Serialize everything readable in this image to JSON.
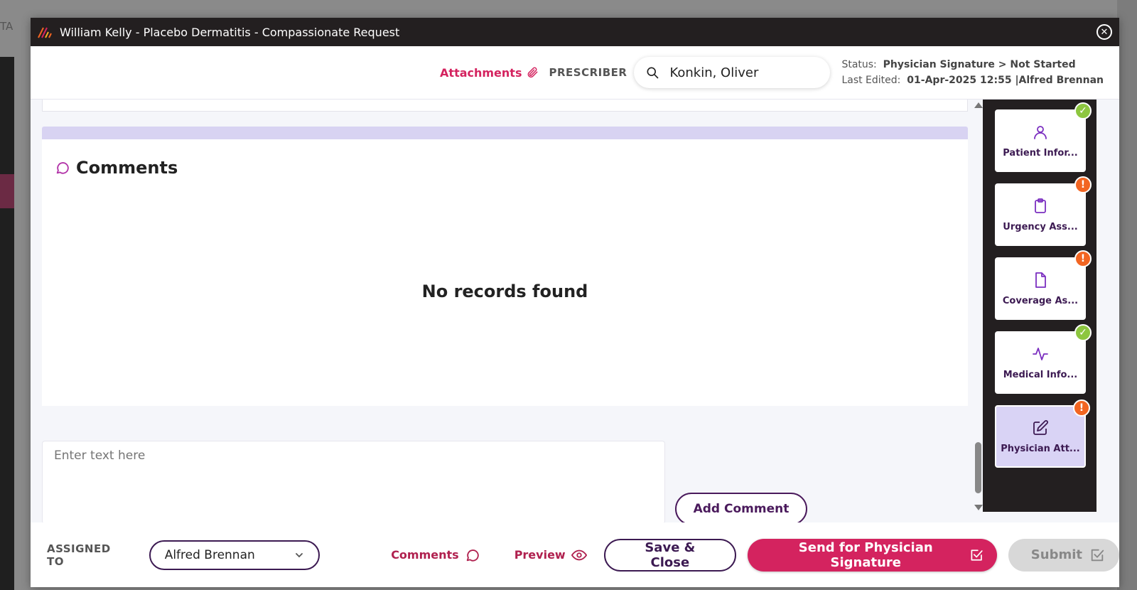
{
  "background": {
    "top_text": "TA"
  },
  "modal": {
    "title": "William Kelly - Placebo Dermatitis - Compassionate Request"
  },
  "header": {
    "attachments_label": "Attachments",
    "prescriber_label": "PRESCRIBER",
    "search_value": "Konkin, Oliver",
    "status_label": "Status:",
    "status_value": "Physician Signature > Not Started",
    "last_edited_label": "Last Edited:",
    "last_edited_value": "01-Apr-2025 12:55 |Alfred Brennan"
  },
  "comments": {
    "title": "Comments",
    "empty_text": "No records found",
    "input_placeholder": "Enter text here",
    "add_button": "Add Comment"
  },
  "rail": {
    "items": [
      {
        "label": "Patient Infor...",
        "icon": "person-icon",
        "status": "complete"
      },
      {
        "label": "Urgency Ass...",
        "icon": "clipboard-icon",
        "status": "warning"
      },
      {
        "label": "Coverage As...",
        "icon": "document-icon",
        "status": "warning"
      },
      {
        "label": "Medical Info...",
        "icon": "pulse-icon",
        "status": "complete"
      },
      {
        "label": "Physician Att...",
        "icon": "edit-icon",
        "status": "warning",
        "active": true
      }
    ]
  },
  "footer": {
    "assigned_label": "ASSIGNED TO",
    "assigned_value": "Alfred Brennan",
    "comments_link": "Comments",
    "preview_link": "Preview",
    "save_close": "Save & Close",
    "send_signature": "Send for Physician Signature",
    "submit": "Submit"
  },
  "colors": {
    "accent_pink": "#d4235f",
    "dark_purple": "#3c1a52",
    "complete_green": "#8dc63f",
    "warning_orange": "#f26522",
    "titlebar": "#231f20"
  }
}
